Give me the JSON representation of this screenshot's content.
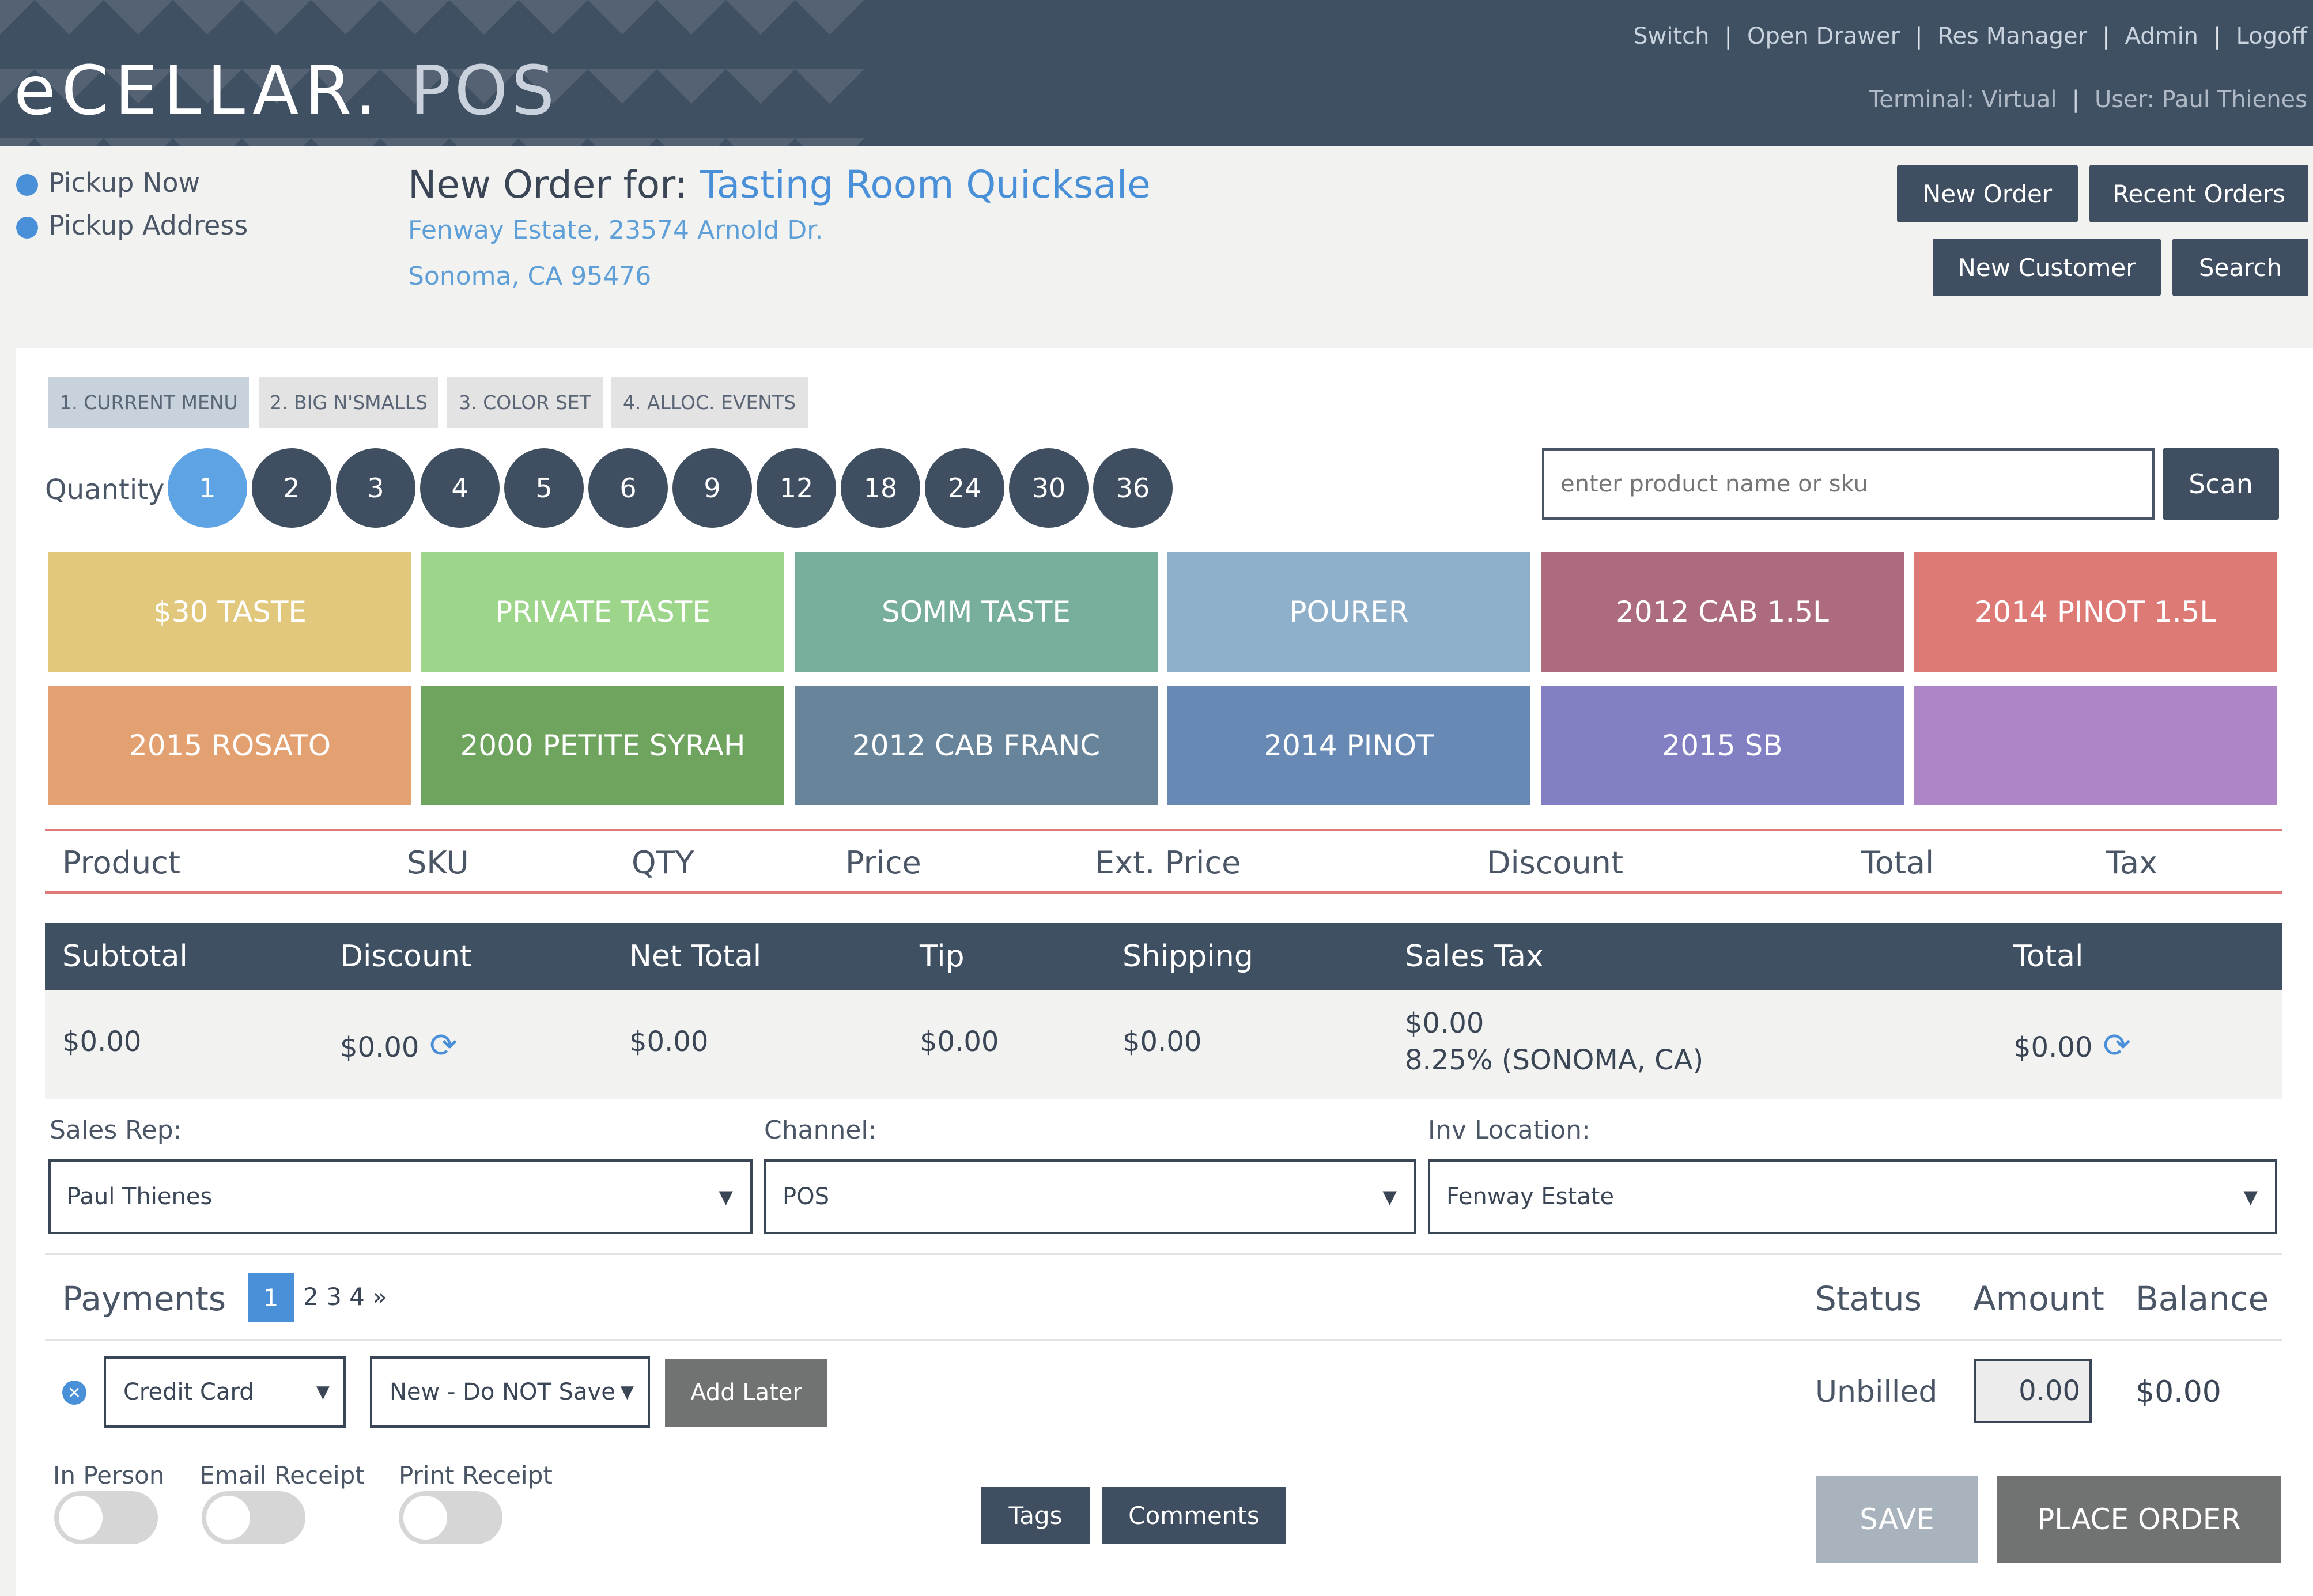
{
  "header": {
    "logo_main": "eCELLAR.",
    "logo_pos": "POS",
    "links": [
      "Switch",
      "Open Drawer",
      "Res Manager",
      "Admin",
      "Logoff"
    ],
    "terminal": "Terminal: Virtual",
    "user": "User: Paul Thienes"
  },
  "pickup": {
    "now": "Pickup Now",
    "address": "Pickup Address"
  },
  "order": {
    "title_prefix": "New Order for:",
    "customer": "Tasting Room Quicksale",
    "address_line1": "Fenway Estate, 23574 Arnold Dr.",
    "address_line2": "Sonoma, CA 95476"
  },
  "actions": {
    "new_order": "New Order",
    "recent_orders": "Recent Orders",
    "new_customer": "New Customer",
    "search": "Search"
  },
  "menu_tabs": [
    "1. CURRENT MENU",
    "2. BIG N'SMALLS",
    "3. COLOR SET",
    "4. ALLOC. EVENTS"
  ],
  "quantity": {
    "label": "Quantity",
    "options": [
      "1",
      "2",
      "3",
      "4",
      "5",
      "6",
      "9",
      "12",
      "18",
      "24",
      "30",
      "36"
    ],
    "selected": "1"
  },
  "product_search": {
    "placeholder": "enter product name or sku",
    "scan_label": "Scan"
  },
  "product_tiles": [
    {
      "label": "$30 TASTE",
      "color": "#e2c87c"
    },
    {
      "label": "PRIVATE TASTE",
      "color": "#9dd58a"
    },
    {
      "label": "SOMM TASTE",
      "color": "#78ae9c"
    },
    {
      "label": "POURER",
      "color": "#8fb0ca"
    },
    {
      "label": "2012 CAB 1.5L",
      "color": "#ad6c7e"
    },
    {
      "label": "2014 PINOT 1.5L",
      "color": "#de7a76"
    },
    {
      "label": "2015 ROSATO",
      "color": "#e3a070"
    },
    {
      "label": "2000 PETITE SYRAH",
      "color": "#6fa45f"
    },
    {
      "label": "2012 CAB FRANC",
      "color": "#67849a"
    },
    {
      "label": "2014 PINOT",
      "color": "#6789b3"
    },
    {
      "label": "2015 SB",
      "color": "#8280c2"
    },
    {
      "label": "",
      "color": "#ae85c6"
    }
  ],
  "line_headers": [
    "Product",
    "SKU",
    "QTY",
    "Price",
    "Ext. Price",
    "Discount",
    "Total",
    "Tax"
  ],
  "totals": {
    "headers": [
      "Subtotal",
      "Discount",
      "Net Total",
      "Tip",
      "Shipping",
      "Sales Tax",
      "Total"
    ],
    "subtotal": "$0.00",
    "discount": "$0.00",
    "net_total": "$0.00",
    "tip": "$0.00",
    "shipping": "$0.00",
    "sales_tax": "$0.00",
    "sales_tax_rate": "8.25% (SONOMA, CA)",
    "total": "$0.00"
  },
  "fields": {
    "sales_rep_label": "Sales Rep:",
    "sales_rep_value": "Paul Thienes",
    "channel_label": "Channel:",
    "channel_value": "POS",
    "inv_location_label": "Inv Location:",
    "inv_location_value": "Fenway Estate"
  },
  "payments": {
    "label": "Payments",
    "current_page": "1",
    "other_pages": "2 3 4 »",
    "status_header": "Status",
    "amount_header": "Amount",
    "balance_header": "Balance",
    "method": "Credit Card",
    "card_option": "New - Do NOT Save",
    "add_later": "Add Later",
    "status": "Unbilled",
    "amount": "0.00",
    "balance": "$0.00"
  },
  "toggles": {
    "in_person": "In Person",
    "email_receipt": "Email Receipt",
    "print_receipt": "Print Receipt"
  },
  "footer_buttons": {
    "tags": "Tags",
    "comments": "Comments",
    "save": "SAVE",
    "place_order": "PLACE ORDER"
  }
}
